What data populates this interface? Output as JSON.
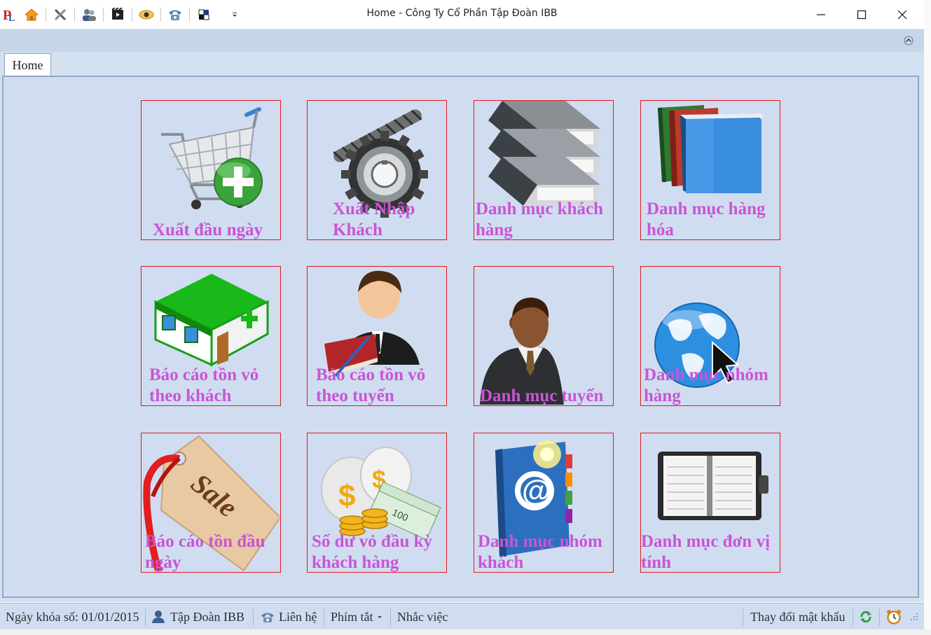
{
  "window": {
    "title": "Home - Công Ty Cổ Phần Tập Đoàn IBB"
  },
  "quick_access": [
    {
      "icon": "app-logo-icon"
    },
    {
      "icon": "home-icon"
    },
    {
      "icon": "tools-icon"
    },
    {
      "icon": "users-icon"
    },
    {
      "icon": "film-icon"
    },
    {
      "icon": "eye-icon"
    },
    {
      "icon": "phone-icon"
    },
    {
      "icon": "pattern-icon"
    },
    {
      "icon": "customize-dropdown-icon"
    }
  ],
  "tabs": [
    {
      "label": "Home",
      "active": true
    }
  ],
  "tiles": [
    {
      "label": "Xuất đầu ngày",
      "icon": "shopping-cart-add-icon"
    },
    {
      "label": "Xuất Nhập Khách",
      "icon": "gears-icon"
    },
    {
      "label": "Danh mục khách hàng",
      "icon": "stacked-folders-icon"
    },
    {
      "label": "Danh mục hàng hóa",
      "icon": "books-icon"
    },
    {
      "label": "Báo cáo tồn vỏ theo khách",
      "icon": "store-building-icon"
    },
    {
      "label": "Báo cáo tồn vỏ theo tuyến",
      "icon": "businessman-book-icon"
    },
    {
      "label": "Danh mục tuyến",
      "icon": "businessman-icon"
    },
    {
      "label": "Danh mục nhóm hàng",
      "icon": "globe-cursor-icon"
    },
    {
      "label": "Báo cáo tồn đầu ngày",
      "icon": "sale-tag-icon"
    },
    {
      "label": "Số dư vỏ đầu kỳ khách hàng",
      "icon": "money-bags-icon"
    },
    {
      "label": "Danh mục nhóm khách",
      "icon": "address-book-icon"
    },
    {
      "label": "Danh mục đơn vị tính",
      "icon": "notebook-icon"
    }
  ],
  "statusbar": {
    "lock_date": "Ngày khóa số: 01/01/2015",
    "company": "Tập Đoàn IBB",
    "contact": "Liên hệ",
    "shortcuts": "Phím tắt",
    "reminders": "Nhắc việc",
    "change_password": "Thay đổi mật khẩu"
  },
  "colors": {
    "tile_border": "#e1181f",
    "tile_label": "#c955d6",
    "panel_bg": "#d0ddf0",
    "ribbon_bg": "#c5d6ea"
  }
}
